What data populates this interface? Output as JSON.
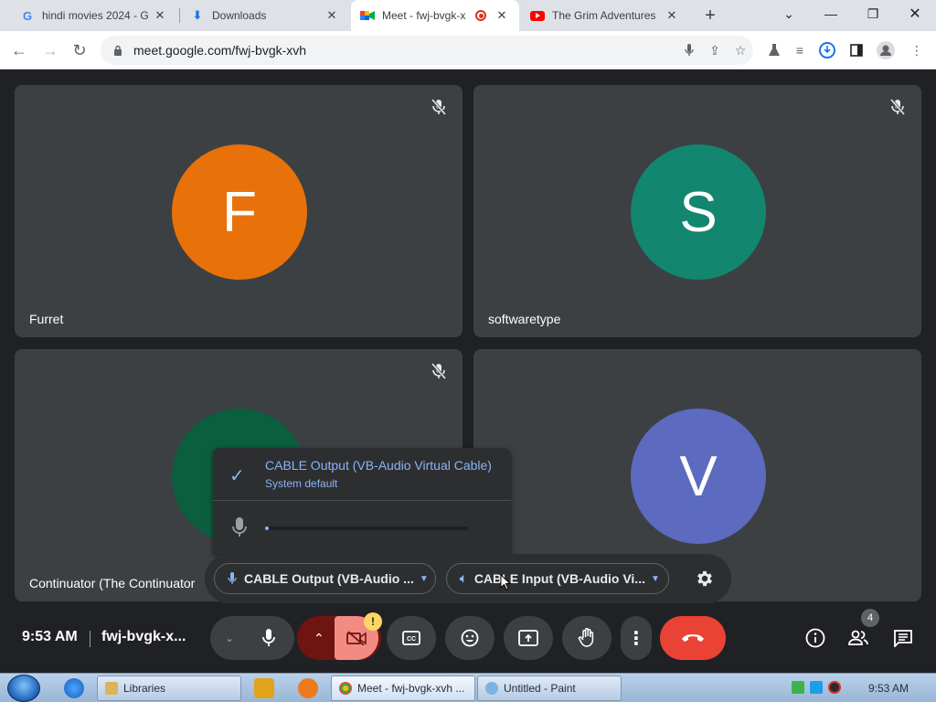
{
  "browser": {
    "tabs": [
      {
        "title": "hindi movies 2024 - G",
        "favicon": "google-icon"
      },
      {
        "title": "Downloads",
        "favicon": "download-icon"
      },
      {
        "title": "Meet - fwj-bvgk-x",
        "favicon": "meet-icon",
        "active": true,
        "recording": true
      },
      {
        "title": "The Grim Adventures",
        "favicon": "youtube-icon"
      }
    ],
    "new_tab": "+",
    "url": "meet.google.com/fwj-bvgk-xvh"
  },
  "meet": {
    "participants": [
      {
        "name": "Furret",
        "initial": "F",
        "color": "#e8710a",
        "muted": true
      },
      {
        "name": "softwaretype",
        "initial": "S",
        "color": "#12866f",
        "muted": true
      },
      {
        "name": "Continuator (The Continuator",
        "initial": "",
        "color": "#0b5e3e",
        "muted": true
      },
      {
        "name": "",
        "initial": "V",
        "color": "#5c6bc0",
        "muted": false
      }
    ],
    "audio_popup": {
      "selected_option": "CABLE Output (VB-Audio Virtual Cable)",
      "selected_sub": "System default",
      "mic_level": 0.02
    },
    "device_bar": {
      "microphone": "CABLE Output (VB-Audio ...",
      "speaker": "CABLE Input (VB-Audio Vi..."
    },
    "bottom": {
      "time": "9:53 AM",
      "meeting_code": "fwj-bvgk-x...",
      "participant_count": "4",
      "warning": "!"
    }
  },
  "taskbar": {
    "tasks": [
      {
        "label": "Libraries"
      },
      {
        "label": "Meet - fwj-bvgk-xvh ..."
      },
      {
        "label": "Untitled - Paint"
      }
    ],
    "clock": "9:53 AM"
  }
}
